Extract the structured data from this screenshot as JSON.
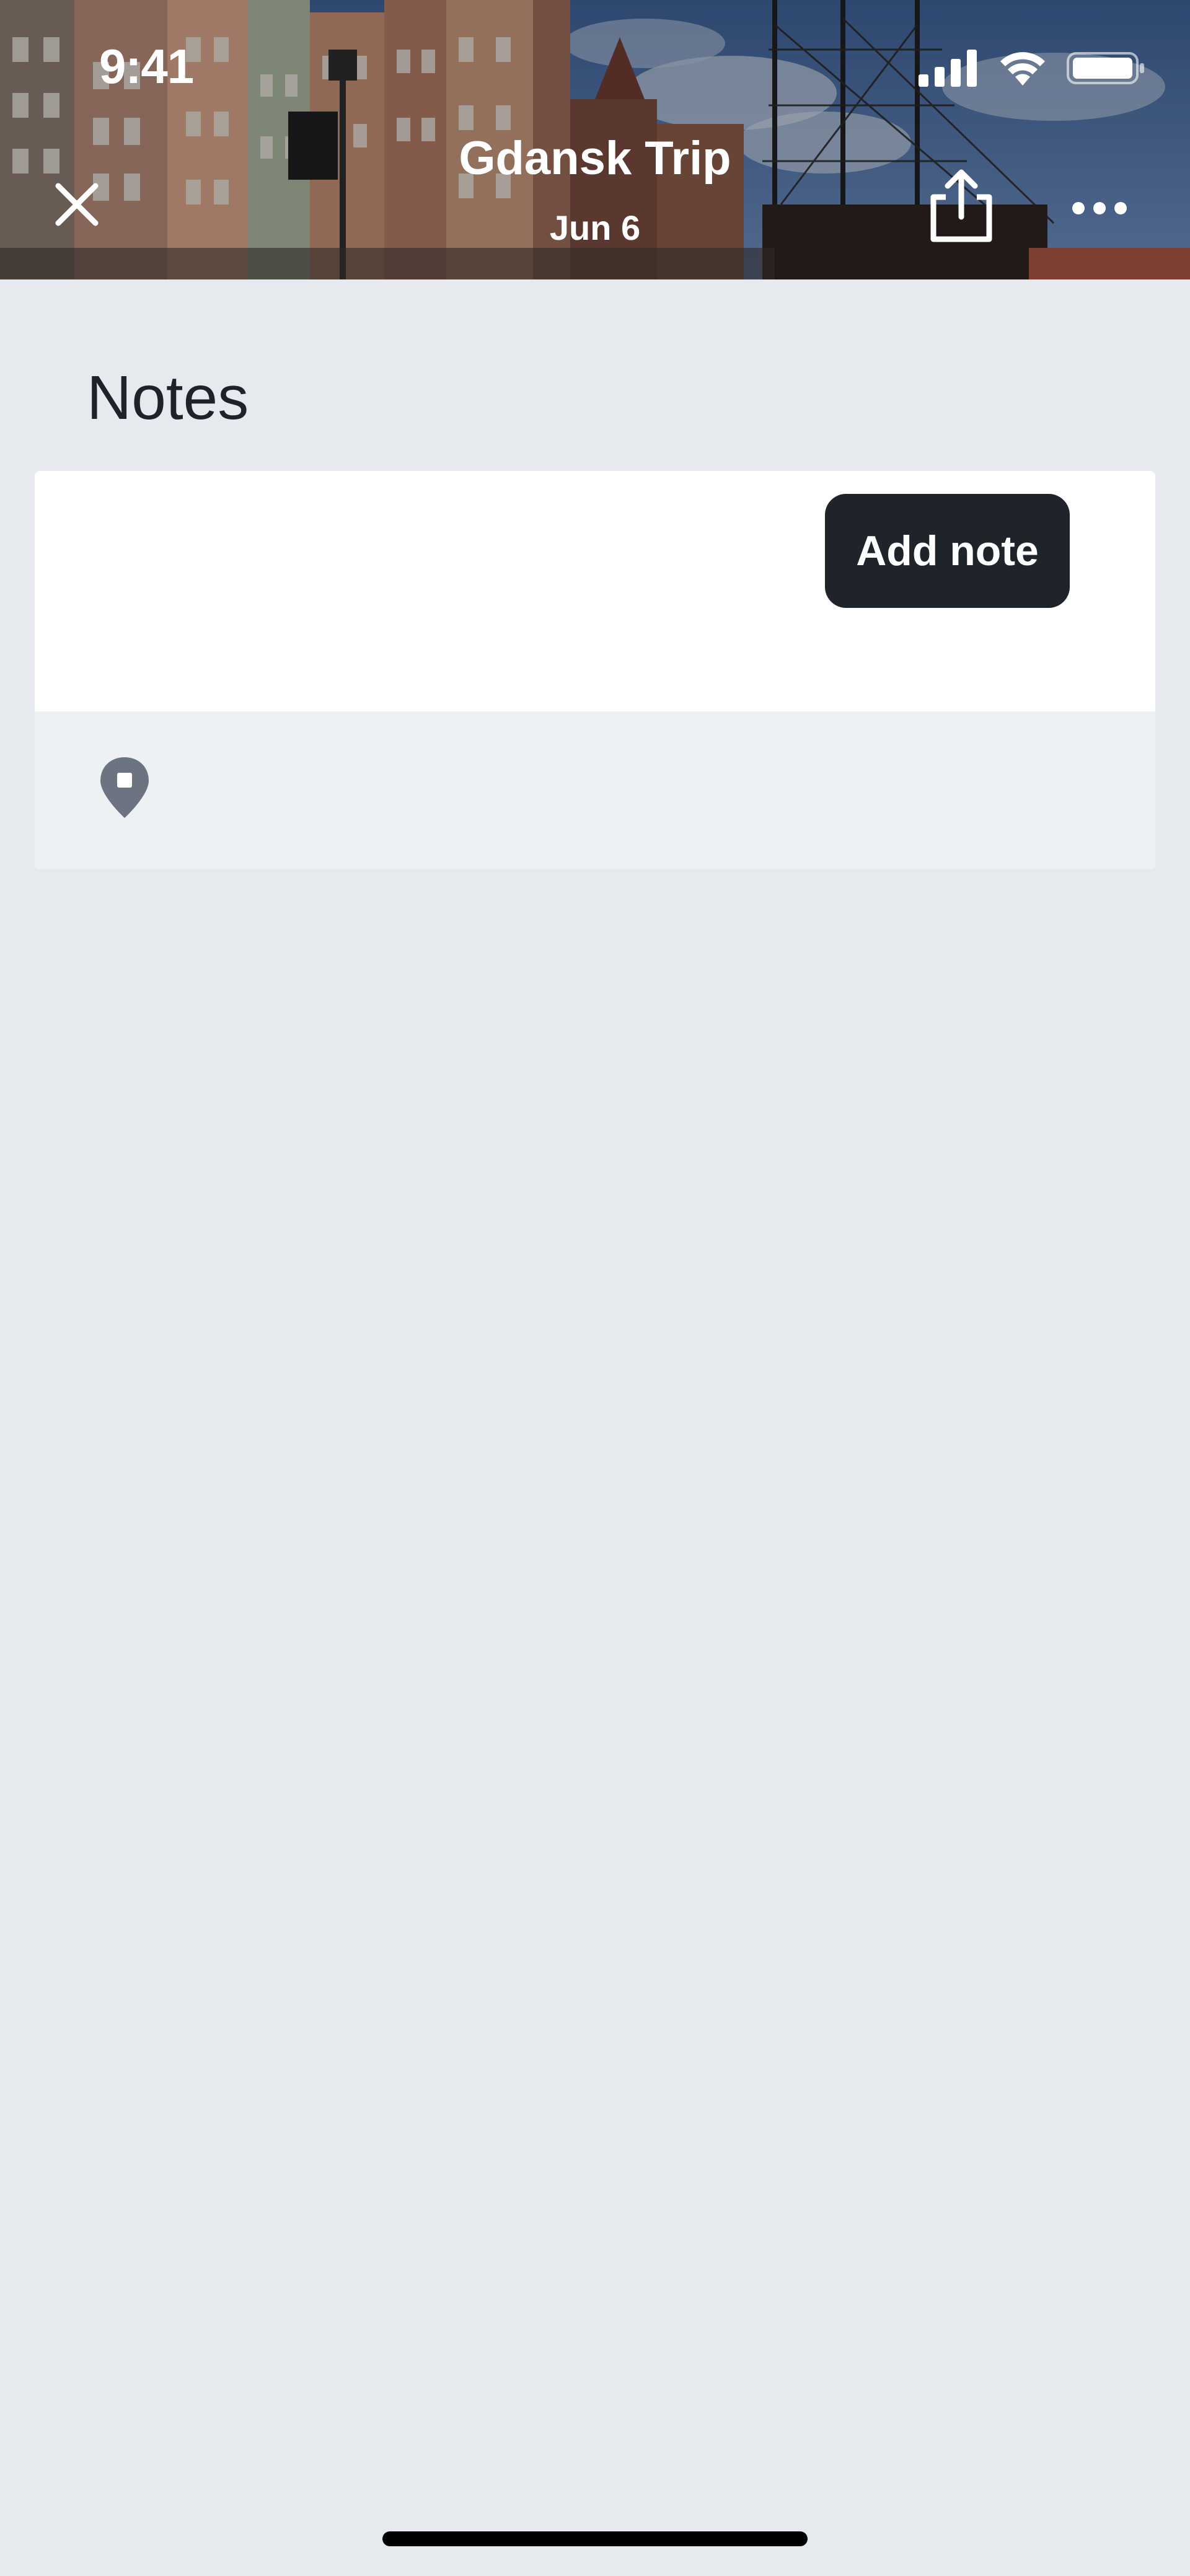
{
  "status_bar": {
    "time": "9:41",
    "icons": [
      "cellular-signal-icon",
      "wifi-icon",
      "battery-icon"
    ]
  },
  "header": {
    "title": "Gdansk Trip",
    "subtitle": "Jun 6",
    "close_icon": "close-icon",
    "share_icon": "share-icon",
    "more_icon": "more-icon"
  },
  "notes": {
    "heading": "Notes",
    "input_value": "",
    "add_button_label": "Add note",
    "location_icon": "location-pin-icon"
  },
  "colors": {
    "background": "#e6e9ee",
    "card": "#ffffff",
    "toolbar": "#eef1f4",
    "primary_button": "#1f242b",
    "icon_gray": "#6b7480",
    "text": "#1f2329"
  }
}
